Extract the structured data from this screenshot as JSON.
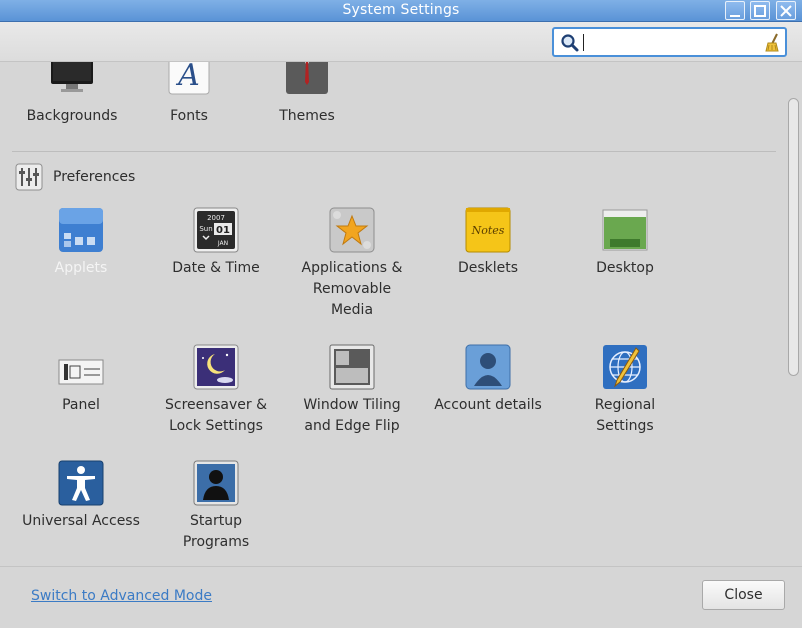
{
  "window": {
    "title": "System Settings"
  },
  "search": {
    "value": "",
    "placeholder": ""
  },
  "top_row": [
    {
      "label": "Backgrounds",
      "icon": "monitor-icon"
    },
    {
      "label": "Fonts",
      "icon": "font-icon"
    },
    {
      "label": "Themes",
      "icon": "themes-suit-icon"
    }
  ],
  "preferences": {
    "title": "Preferences",
    "icon": "preferences-sliders-icon",
    "items": [
      {
        "label": "Applets",
        "icon": "applets-icon",
        "selected": true
      },
      {
        "label": "Date & Time",
        "icon": "calendar-icon",
        "calendar": {
          "year": "2007",
          "weekday": "Sun",
          "day": "01",
          "month": "JAN"
        }
      },
      {
        "label": "Applications & Removable Media",
        "icon": "media-star-icon"
      },
      {
        "label": "Desklets",
        "icon": "notes-icon",
        "note_text": "Notes"
      },
      {
        "label": "Desktop",
        "icon": "desktop-icon"
      },
      {
        "label": "Panel",
        "icon": "panel-icon"
      },
      {
        "label": "Screensaver & Lock Settings",
        "icon": "screensaver-moon-icon"
      },
      {
        "label": "Window Tiling and Edge Flip",
        "icon": "window-tiling-icon"
      },
      {
        "label": "Account details",
        "icon": "user-account-icon"
      },
      {
        "label": "Regional Settings",
        "icon": "globe-icon"
      },
      {
        "label": "Universal Access",
        "icon": "accessibility-icon"
      },
      {
        "label": "Startup Programs",
        "icon": "startup-silhouette-icon"
      }
    ]
  },
  "footer": {
    "advanced_link": "Switch to Advanced Mode",
    "close_label": "Close"
  },
  "colors": {
    "titlebar": "#5a93d6",
    "link": "#3b7bc5",
    "background": "#d6d6d6"
  }
}
